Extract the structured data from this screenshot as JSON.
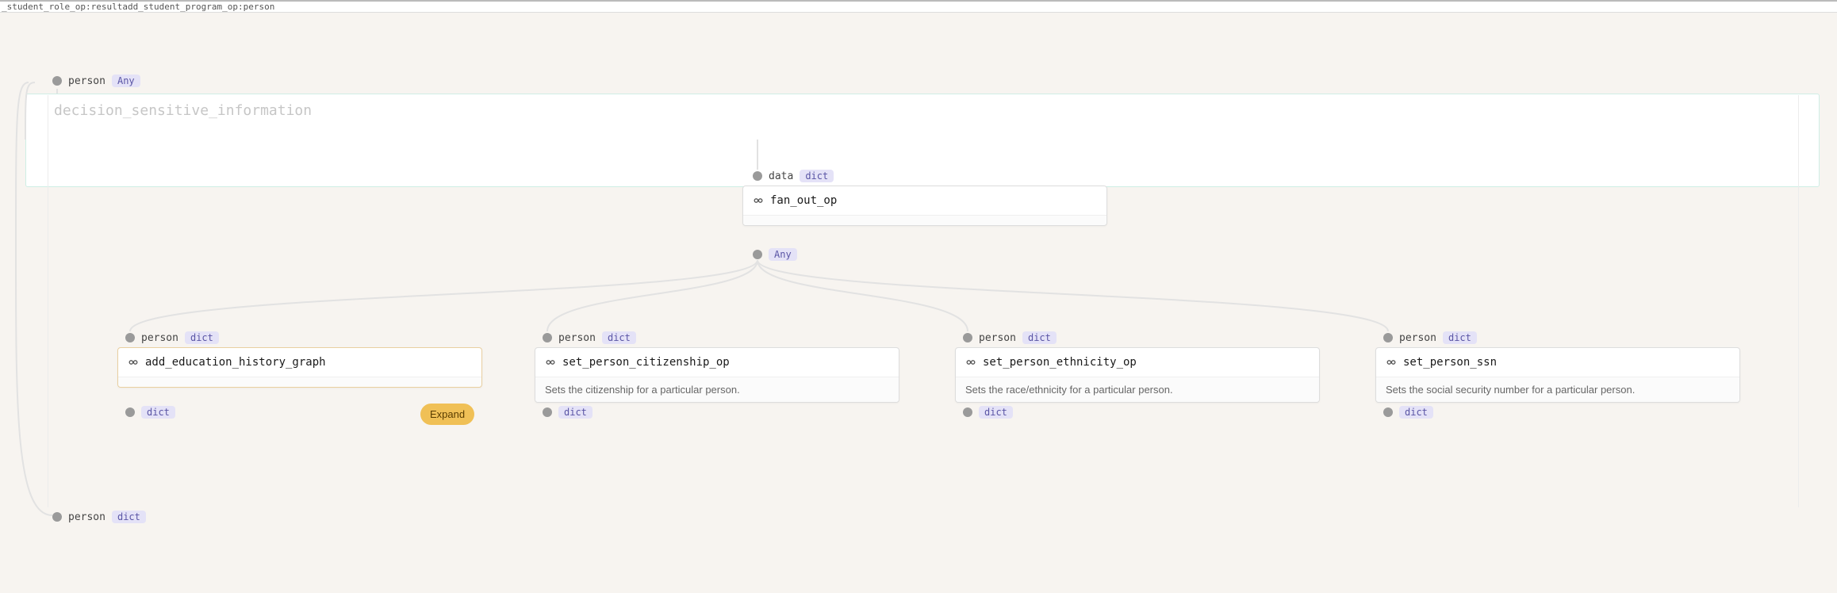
{
  "topbar": {
    "crumb": "_student_role_op:resultadd_student_program_op:person"
  },
  "colors": {
    "any_chip": "#e4e2f7",
    "dict_chip": "#e4e2f7",
    "expand_bg": "#f0c056"
  },
  "title": {
    "text": "decision_sensitive_information"
  },
  "ports": {
    "top_input": {
      "label": "person",
      "type": "Any"
    },
    "fan_in": {
      "label": "data",
      "type": "dict"
    },
    "fan_out": {
      "type": "Any"
    },
    "bottom_output": {
      "label": "person",
      "type": "dict"
    },
    "ops": [
      {
        "in_label": "person",
        "in_type": "dict",
        "out_type": "dict"
      },
      {
        "in_label": "person",
        "in_type": "dict",
        "out_type": "dict"
      },
      {
        "in_label": "person",
        "in_type": "dict",
        "out_type": "dict"
      },
      {
        "in_label": "person",
        "in_type": "dict",
        "out_type": "dict"
      }
    ]
  },
  "nodes": {
    "fanout": {
      "title": "fan_out_op"
    },
    "ops": [
      {
        "title": "add_education_history_graph",
        "desc": ""
      },
      {
        "title": "set_person_citizenship_op",
        "desc": "Sets the citizenship for a particular person."
      },
      {
        "title": "set_person_ethnicity_op",
        "desc": "Sets the race/ethnicity for a particular person."
      },
      {
        "title": "set_person_ssn",
        "desc": "Sets the social security number for a particular person."
      }
    ]
  },
  "actions": {
    "expand": "Expand"
  }
}
